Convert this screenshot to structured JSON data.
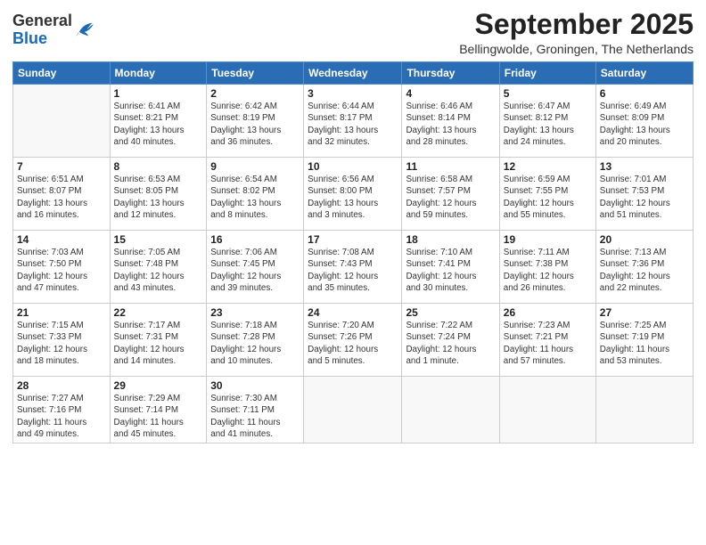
{
  "header": {
    "logo_general": "General",
    "logo_blue": "Blue",
    "month": "September 2025",
    "location": "Bellingwolde, Groningen, The Netherlands"
  },
  "days_of_week": [
    "Sunday",
    "Monday",
    "Tuesday",
    "Wednesday",
    "Thursday",
    "Friday",
    "Saturday"
  ],
  "weeks": [
    [
      {
        "day": "",
        "info": ""
      },
      {
        "day": "1",
        "info": "Sunrise: 6:41 AM\nSunset: 8:21 PM\nDaylight: 13 hours\nand 40 minutes."
      },
      {
        "day": "2",
        "info": "Sunrise: 6:42 AM\nSunset: 8:19 PM\nDaylight: 13 hours\nand 36 minutes."
      },
      {
        "day": "3",
        "info": "Sunrise: 6:44 AM\nSunset: 8:17 PM\nDaylight: 13 hours\nand 32 minutes."
      },
      {
        "day": "4",
        "info": "Sunrise: 6:46 AM\nSunset: 8:14 PM\nDaylight: 13 hours\nand 28 minutes."
      },
      {
        "day": "5",
        "info": "Sunrise: 6:47 AM\nSunset: 8:12 PM\nDaylight: 13 hours\nand 24 minutes."
      },
      {
        "day": "6",
        "info": "Sunrise: 6:49 AM\nSunset: 8:09 PM\nDaylight: 13 hours\nand 20 minutes."
      }
    ],
    [
      {
        "day": "7",
        "info": "Sunrise: 6:51 AM\nSunset: 8:07 PM\nDaylight: 13 hours\nand 16 minutes."
      },
      {
        "day": "8",
        "info": "Sunrise: 6:53 AM\nSunset: 8:05 PM\nDaylight: 13 hours\nand 12 minutes."
      },
      {
        "day": "9",
        "info": "Sunrise: 6:54 AM\nSunset: 8:02 PM\nDaylight: 13 hours\nand 8 minutes."
      },
      {
        "day": "10",
        "info": "Sunrise: 6:56 AM\nSunset: 8:00 PM\nDaylight: 13 hours\nand 3 minutes."
      },
      {
        "day": "11",
        "info": "Sunrise: 6:58 AM\nSunset: 7:57 PM\nDaylight: 12 hours\nand 59 minutes."
      },
      {
        "day": "12",
        "info": "Sunrise: 6:59 AM\nSunset: 7:55 PM\nDaylight: 12 hours\nand 55 minutes."
      },
      {
        "day": "13",
        "info": "Sunrise: 7:01 AM\nSunset: 7:53 PM\nDaylight: 12 hours\nand 51 minutes."
      }
    ],
    [
      {
        "day": "14",
        "info": "Sunrise: 7:03 AM\nSunset: 7:50 PM\nDaylight: 12 hours\nand 47 minutes."
      },
      {
        "day": "15",
        "info": "Sunrise: 7:05 AM\nSunset: 7:48 PM\nDaylight: 12 hours\nand 43 minutes."
      },
      {
        "day": "16",
        "info": "Sunrise: 7:06 AM\nSunset: 7:45 PM\nDaylight: 12 hours\nand 39 minutes."
      },
      {
        "day": "17",
        "info": "Sunrise: 7:08 AM\nSunset: 7:43 PM\nDaylight: 12 hours\nand 35 minutes."
      },
      {
        "day": "18",
        "info": "Sunrise: 7:10 AM\nSunset: 7:41 PM\nDaylight: 12 hours\nand 30 minutes."
      },
      {
        "day": "19",
        "info": "Sunrise: 7:11 AM\nSunset: 7:38 PM\nDaylight: 12 hours\nand 26 minutes."
      },
      {
        "day": "20",
        "info": "Sunrise: 7:13 AM\nSunset: 7:36 PM\nDaylight: 12 hours\nand 22 minutes."
      }
    ],
    [
      {
        "day": "21",
        "info": "Sunrise: 7:15 AM\nSunset: 7:33 PM\nDaylight: 12 hours\nand 18 minutes."
      },
      {
        "day": "22",
        "info": "Sunrise: 7:17 AM\nSunset: 7:31 PM\nDaylight: 12 hours\nand 14 minutes."
      },
      {
        "day": "23",
        "info": "Sunrise: 7:18 AM\nSunset: 7:28 PM\nDaylight: 12 hours\nand 10 minutes."
      },
      {
        "day": "24",
        "info": "Sunrise: 7:20 AM\nSunset: 7:26 PM\nDaylight: 12 hours\nand 5 minutes."
      },
      {
        "day": "25",
        "info": "Sunrise: 7:22 AM\nSunset: 7:24 PM\nDaylight: 12 hours\nand 1 minute."
      },
      {
        "day": "26",
        "info": "Sunrise: 7:23 AM\nSunset: 7:21 PM\nDaylight: 11 hours\nand 57 minutes."
      },
      {
        "day": "27",
        "info": "Sunrise: 7:25 AM\nSunset: 7:19 PM\nDaylight: 11 hours\nand 53 minutes."
      }
    ],
    [
      {
        "day": "28",
        "info": "Sunrise: 7:27 AM\nSunset: 7:16 PM\nDaylight: 11 hours\nand 49 minutes."
      },
      {
        "day": "29",
        "info": "Sunrise: 7:29 AM\nSunset: 7:14 PM\nDaylight: 11 hours\nand 45 minutes."
      },
      {
        "day": "30",
        "info": "Sunrise: 7:30 AM\nSunset: 7:11 PM\nDaylight: 11 hours\nand 41 minutes."
      },
      {
        "day": "",
        "info": ""
      },
      {
        "day": "",
        "info": ""
      },
      {
        "day": "",
        "info": ""
      },
      {
        "day": "",
        "info": ""
      }
    ]
  ]
}
